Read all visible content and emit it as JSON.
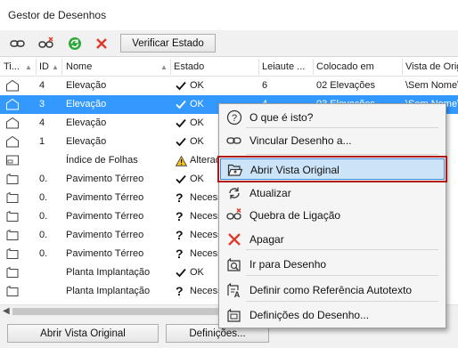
{
  "window": {
    "title": "Gestor de Desenhos"
  },
  "toolbar": {
    "icons": [
      "link-drawing-icon",
      "break-link-icon",
      "update-icon",
      "delete-icon"
    ],
    "verify_button": "Verificar Estado"
  },
  "table": {
    "columns": {
      "type": "Ti...",
      "id": "ID",
      "name": "Nome",
      "status": "Estado",
      "layout": "Leiaute ...",
      "placed": "Colocado em",
      "source": "Vista de Orig"
    },
    "rows": [
      {
        "icon": "elevation-icon",
        "id": "4",
        "name": "Elevação",
        "status_icon": "check",
        "status": "OK",
        "layout": "6",
        "placed": "02 Elevações",
        "source": "\\Sem Nome\\",
        "selected": false
      },
      {
        "icon": "elevation-icon",
        "id": "3",
        "name": "Elevação",
        "status_icon": "check",
        "status": "OK",
        "layout": "4",
        "placed": "03 Elevações",
        "source": "\\Sem Nome\\",
        "selected": true
      },
      {
        "icon": "elevation-icon",
        "id": "4",
        "name": "Elevação",
        "status_icon": "check",
        "status": "OK",
        "layout": "",
        "placed": "",
        "source": "",
        "selected": false
      },
      {
        "icon": "elevation-icon",
        "id": "1",
        "name": "Elevação",
        "status_icon": "check",
        "status": "OK",
        "layout": "",
        "placed": "",
        "source": "",
        "selected": false
      },
      {
        "icon": "sheet-index-icon",
        "id": "",
        "name": "Índice de Folhas",
        "status_icon": "warning",
        "status": "Alterad",
        "layout": "",
        "placed": "",
        "source": "",
        "selected": false
      },
      {
        "icon": "drawing-icon",
        "id": "0.",
        "name": "Pavimento Térreo",
        "status_icon": "check",
        "status": "OK",
        "layout": "",
        "placed": "",
        "source": "",
        "selected": false
      },
      {
        "icon": "drawing-icon",
        "id": "0.",
        "name": "Pavimento Térreo",
        "status_icon": "question",
        "status": "Necess",
        "layout": "",
        "placed": "",
        "source": "",
        "selected": false
      },
      {
        "icon": "drawing-icon",
        "id": "0.",
        "name": "Pavimento Térreo",
        "status_icon": "question",
        "status": "Necess",
        "layout": "",
        "placed": "",
        "source": "",
        "selected": false
      },
      {
        "icon": "drawing-icon",
        "id": "0.",
        "name": "Pavimento Térreo",
        "status_icon": "question",
        "status": "Necess",
        "layout": "",
        "placed": "",
        "source": "",
        "selected": false
      },
      {
        "icon": "drawing-icon",
        "id": "0.",
        "name": "Pavimento Térreo",
        "status_icon": "question",
        "status": "Necess",
        "layout": "",
        "placed": "",
        "source": "",
        "selected": false
      },
      {
        "icon": "drawing-icon",
        "id": "",
        "name": "Planta Implantação",
        "status_icon": "check",
        "status": "OK",
        "layout": "",
        "placed": "",
        "source": "",
        "selected": false
      },
      {
        "icon": "drawing-icon",
        "id": "",
        "name": "Planta Implantação",
        "status_icon": "question",
        "status": "Necess",
        "layout": "",
        "placed": "",
        "source": "",
        "selected": false
      }
    ]
  },
  "bottom": {
    "open_original": "Abrir Vista Original",
    "settings": "Definições..."
  },
  "context_menu": {
    "items": [
      {
        "icon": "help-icon",
        "label": "O que é isto?"
      },
      {
        "icon": "link-drawing-icon",
        "label": "Vincular Desenho a..."
      },
      {
        "icon": "open-folder-icon",
        "label": "Abrir Vista Original",
        "highlighted": true
      },
      {
        "icon": "update-icon",
        "label": "Atualizar"
      },
      {
        "icon": "break-link-icon",
        "label": "Quebra de Ligação"
      },
      {
        "icon": "delete-icon",
        "label": "Apagar"
      },
      {
        "icon": "go-to-drawing-icon",
        "label": "Ir para Desenho"
      },
      {
        "icon": "autotext-icon",
        "label": "Definir como Referência Autotexto"
      },
      {
        "icon": "drawing-settings-icon",
        "label": "Definições do Desenho..."
      }
    ]
  },
  "colors": {
    "selection": "#3399ff",
    "menu_highlight": "#cce4f7",
    "highlight_outline": "#b01818",
    "delete_red": "#e03a2a",
    "update_green": "#2fa83a"
  }
}
